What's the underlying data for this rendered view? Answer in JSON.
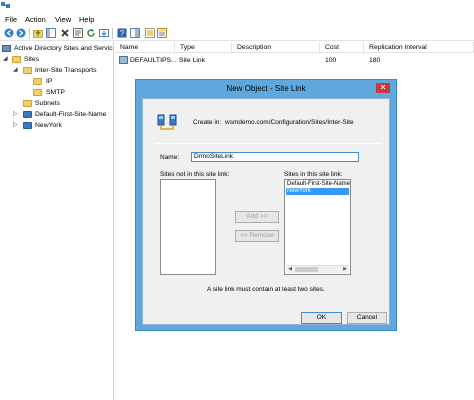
{
  "menu": {
    "file": "File",
    "action": "Action",
    "view": "View",
    "help": "Help"
  },
  "tree": {
    "root": "Active Directory Sites and Services",
    "sites": "Sites",
    "inter_site_transports": "Inter-Site Transports",
    "ip": "IP",
    "smtp": "SMTP",
    "subnets": "Subnets",
    "default_site": "Default-First-Site-Name",
    "newyork": "NewYork"
  },
  "list": {
    "columns": [
      "Name",
      "Type",
      "Description",
      "Cost",
      "Replication Interval"
    ],
    "rows": [
      {
        "name": "DEFAULTIPS...",
        "type": "Site Link",
        "description": "",
        "cost": "100",
        "interval": "180"
      }
    ]
  },
  "dialog": {
    "title": "New Object - Site Link",
    "close": "✕",
    "create_in_label": "Create in:",
    "create_in_value": "wsmdemo.com/Configuration/Sites/Inter-Site",
    "name_label": "Name:",
    "name_value": "DrmoSiteLink",
    "not_in_label": "Sites not in this site link:",
    "in_label": "Sites in this site link:",
    "in_items": [
      "Default-First-Site-Name",
      "NewYork"
    ],
    "selected_index": 1,
    "add_button": "Add >>",
    "remove_button": "<< Remove",
    "hint": "A site link must contain at least two sites.",
    "ok_button": "OK",
    "cancel_button": "Cancel"
  },
  "colors": {
    "dialog_frame": "#5fa7dc",
    "selection": "#3399ff",
    "input_focus": "#3c8ddc",
    "close_red": "#c8383b"
  }
}
